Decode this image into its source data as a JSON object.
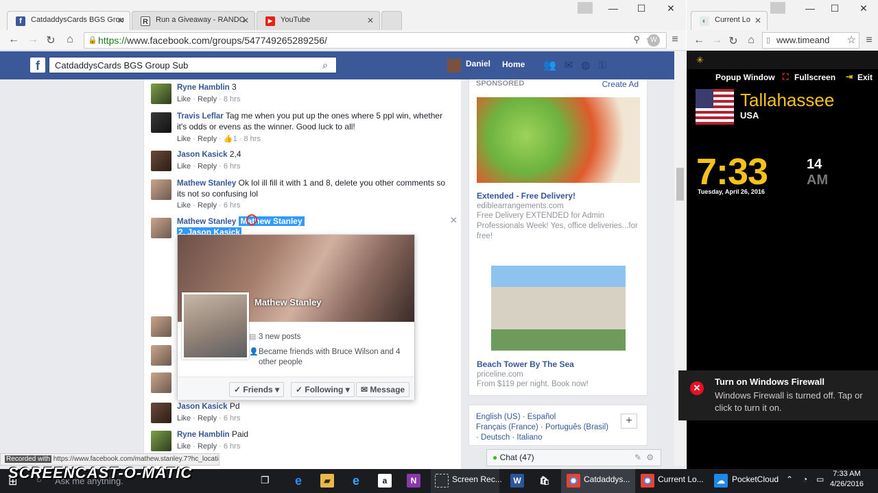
{
  "browser1": {
    "tabs": [
      {
        "label": "CatdaddysCards BGS Grou",
        "icon": "facebook-icon",
        "color": "#3b5998"
      },
      {
        "label": "Run a Giveaway - RANDO",
        "icon": "random-org-icon",
        "color": "#555555"
      },
      {
        "label": "YouTube",
        "icon": "youtube-icon",
        "color": "#e62117"
      }
    ],
    "url_scheme": "https://",
    "url_host": "www.facebook.com",
    "url_path": "/groups/547749265289256/"
  },
  "facebook": {
    "search_value": "CatdaddysCards BGS Group Sub",
    "user_name": "Daniel",
    "home_label": "Home"
  },
  "comments": [
    {
      "name": "Ryne Hamblin",
      "text": "3",
      "like": "Like",
      "reply": "Reply",
      "time": "8 hrs",
      "likes": ""
    },
    {
      "name": "Travis Leflar",
      "text": "Tag me when you put up the ones where 5 ppl win, whether it's odds or evens as the winner. Good luck to all!",
      "like": "Like",
      "reply": "Reply",
      "time": "8 hrs",
      "likes": "1"
    },
    {
      "name": "Jason Kasick",
      "text": "2,4",
      "like": "Like",
      "reply": "Reply",
      "time": "6 hrs",
      "likes": ""
    },
    {
      "name": "Mathew Stanley",
      "text": "Ok lol ill fill it with 1 and 8, delete you other comments so its not so confusing lol",
      "like": "Like",
      "reply": "Reply",
      "time": "6 hrs",
      "likes": ""
    },
    {
      "name": "Mathew Stanley",
      "text": "Mathew Stanley",
      "text2": "2. Jason Kasick",
      "like": "",
      "reply": "",
      "time": "",
      "likes": ""
    },
    {
      "name": "Jason Kasick",
      "text": "Pd",
      "like": "Like",
      "reply": "Reply",
      "time": "6 hrs",
      "likes": ""
    },
    {
      "name": "Ryne Hamblin",
      "text": "Paid",
      "like": "Like",
      "reply": "Reply",
      "time": "6 hrs",
      "likes": ""
    }
  ],
  "hovercard": {
    "name": "Mathew Stanley",
    "posts": "3 new posts",
    "friends_note": "Became friends with Bruce Wilson and 4 other people",
    "btn_friends": "Friends",
    "btn_following": "Following",
    "btn_message": "Message"
  },
  "ads": {
    "sponsored": "SPONSORED",
    "create": "Create Ad",
    "ad1": {
      "title": "Extended - Free Delivery!",
      "domain": "ediblearrangements.com",
      "body": "Free Delivery EXTENDED for Admin Professionals Week! Yes, office deliveries...for free!"
    },
    "ad2": {
      "title": "Beach Tower By The Sea",
      "domain": "priceline.com",
      "body": "From $119 per night. Book now!"
    }
  },
  "languages": {
    "line1": "English (US) · Español",
    "line2": "Français (France) · Português (Brasil)",
    "line3": "· Deutsch · Italiano",
    "plus": "+"
  },
  "chat": {
    "label": "Chat (47)"
  },
  "status_url": "https://www.facebook.com/mathew.stanley.7?hc_location=ufi",
  "status_overlay": "Recorded with",
  "browser2": {
    "tab_label": "Current Lo",
    "url": "www.timeand",
    "popup_label": "Popup Window",
    "fullscreen_label": "Fullscreen",
    "exit_label": "Exit",
    "city": "Tallahassee",
    "country": "USA",
    "time": "7:33",
    "seconds": "14",
    "ampm": "AM",
    "date": "Tuesday, April 26, 2016"
  },
  "notification": {
    "title": "Turn on Windows Firewall",
    "body": "Windows Firewall is turned off. Tap or click to turn it on."
  },
  "taskbar": {
    "search": "Ask me anything.",
    "items": [
      "Screen Rec...",
      "Catdaddys...",
      "Current Lo...",
      "PocketCloud"
    ],
    "time": "7:33 AM",
    "date": "4/26/2016",
    "watermark": "SCREENCAST-O-MATIC"
  }
}
